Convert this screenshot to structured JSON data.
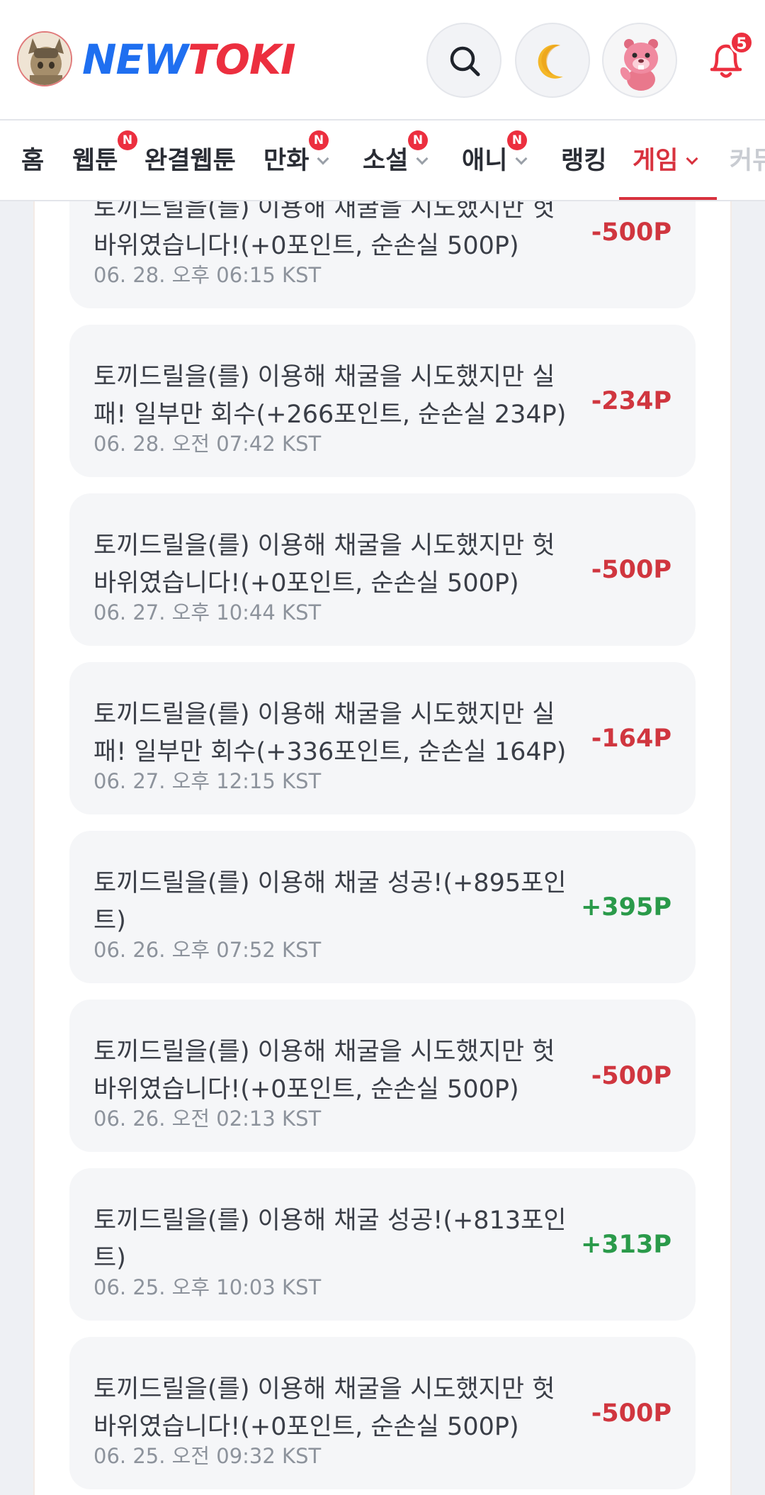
{
  "header": {
    "logo_new": "NEW",
    "logo_toki": "TOKI",
    "notification_count": "5"
  },
  "nav": {
    "items": [
      {
        "label": "홈",
        "badge": "",
        "chevron": false
      },
      {
        "label": "웹툰",
        "badge": "N",
        "chevron": false
      },
      {
        "label": "완결웹툰",
        "badge": "",
        "chevron": false
      },
      {
        "label": "만화",
        "badge": "N",
        "chevron": true
      },
      {
        "label": "소설",
        "badge": "N",
        "chevron": true
      },
      {
        "label": "애니",
        "badge": "N",
        "chevron": true
      },
      {
        "label": "랭킹",
        "badge": "",
        "chevron": false
      },
      {
        "label": "게임",
        "badge": "",
        "chevron": true,
        "active": true
      },
      {
        "label": "커뮤",
        "badge": "",
        "chevron": false
      }
    ]
  },
  "colors": {
    "accent": "#d8323e",
    "negative": "#d0363f",
    "positive": "#2a9a4a"
  },
  "history": [
    {
      "text_line1": "토끼드릴을(를) 이용해 채굴을 시도했지만 헛",
      "text_line2": "바위였습니다!(+0포인트, 순손실 500P)",
      "time": "06. 28. 오후 06:15 KST",
      "amount": "-500P",
      "sign": "neg"
    },
    {
      "text_line1": "토끼드릴을(를) 이용해 채굴을 시도했지만 실",
      "text_line2": "패! 일부만 회수(+266포인트, 순손실 234P)",
      "time": "06. 28. 오전 07:42 KST",
      "amount": "-234P",
      "sign": "neg"
    },
    {
      "text_line1": "토끼드릴을(를) 이용해 채굴을 시도했지만 헛",
      "text_line2": "바위였습니다!(+0포인트, 순손실 500P)",
      "time": "06. 27. 오후 10:44 KST",
      "amount": "-500P",
      "sign": "neg"
    },
    {
      "text_line1": "토끼드릴을(를) 이용해 채굴을 시도했지만 실",
      "text_line2": "패! 일부만 회수(+336포인트, 순손실 164P)",
      "time": "06. 27. 오후 12:15 KST",
      "amount": "-164P",
      "sign": "neg"
    },
    {
      "text_line1": "토끼드릴을(를) 이용해 채굴 성공!(+895포인",
      "text_line2": "트)",
      "time": "06. 26. 오후 07:52 KST",
      "amount": "+395P",
      "sign": "pos"
    },
    {
      "text_line1": "토끼드릴을(를) 이용해 채굴을 시도했지만 헛",
      "text_line2": "바위였습니다!(+0포인트, 순손실 500P)",
      "time": "06. 26. 오전 02:13 KST",
      "amount": "-500P",
      "sign": "neg"
    },
    {
      "text_line1": "토끼드릴을(를) 이용해 채굴 성공!(+813포인",
      "text_line2": "트)",
      "time": "06. 25. 오후 10:03 KST",
      "amount": "+313P",
      "sign": "pos"
    },
    {
      "text_line1": "토끼드릴을(를) 이용해 채굴을 시도했지만 헛",
      "text_line2": "바위였습니다!(+0포인트, 순손실 500P)",
      "time": "06. 25. 오전 09:32 KST",
      "amount": "-500P",
      "sign": "neg"
    }
  ]
}
